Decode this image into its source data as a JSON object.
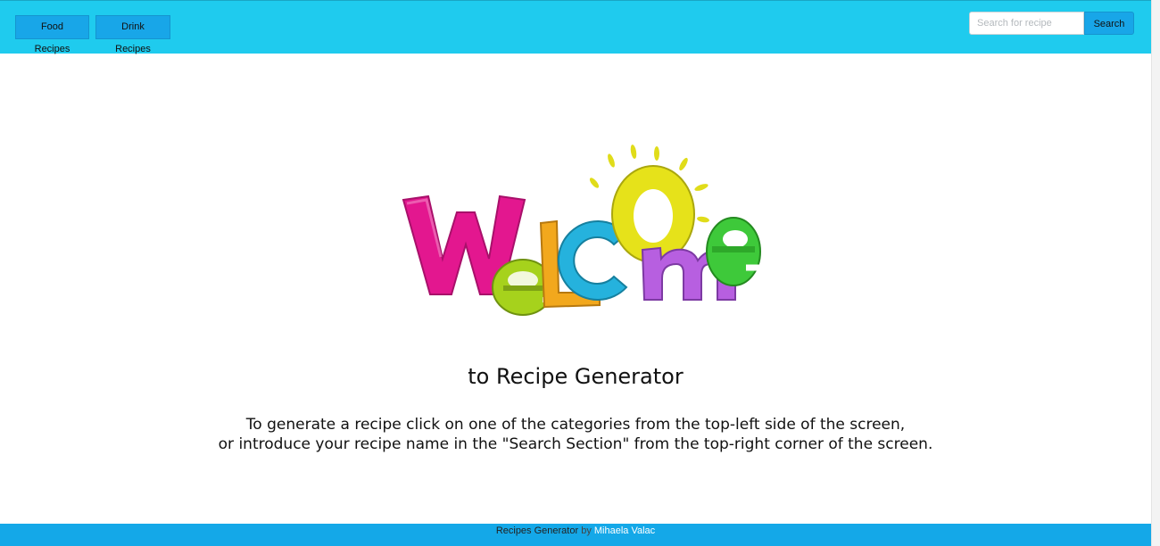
{
  "nav": {
    "food_label": "Food Recipes",
    "drink_label": "Drink Recipes"
  },
  "search": {
    "placeholder": "Search for recipe",
    "value": "",
    "button_label": "Search"
  },
  "hero": {
    "logo_letters": [
      "W",
      "e",
      "L",
      "C",
      "O",
      "m",
      "e"
    ],
    "subtitle": "to Recipe Generator",
    "description_line1": "To generate a recipe click on one of the categories from the top-left side of the screen,",
    "description_line2": "or introduce your recipe name in the \"Search Section\" from the top-right corner of the screen."
  },
  "footer": {
    "brand": "Recipes Generator",
    "by": "by",
    "author": "Mihaela Valac"
  },
  "colors": {
    "topbar": "#1fcbee",
    "button": "#18a6e8",
    "footer": "#14a8e8",
    "letter_w": "#e3178f",
    "letter_e1": "#a6d21c",
    "letter_l": "#f2a81d",
    "letter_c": "#25b2dd",
    "letter_o": "#e6e21a",
    "letter_m": "#b75fe0",
    "letter_e2": "#3ec93a"
  }
}
